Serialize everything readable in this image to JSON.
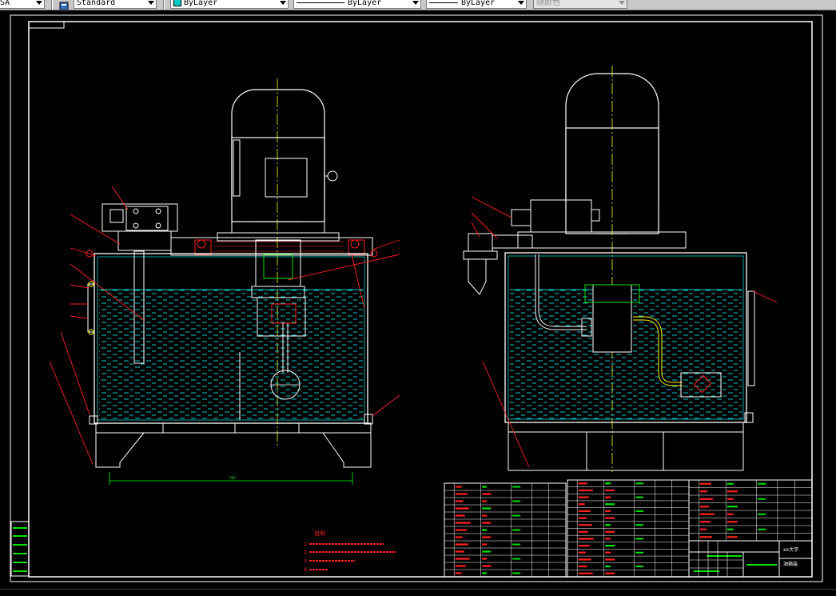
{
  "toolbar": {
    "textstyle_value": "Standard",
    "dimstyle_value": "SA",
    "layer_value": "ByLayer",
    "linetype_value": "ByLayer",
    "lineweight_value": "ByLayer",
    "plotstyle_value": "随颜色"
  },
  "drawing": {
    "notes_title": "说明",
    "notes": [
      "1.",
      "2.",
      "3.",
      "4."
    ],
    "dimension_width": "700",
    "title_school": "xx大学",
    "title_drawing": "油箱装",
    "colors": {
      "outline": "#ffffff",
      "oil": "#00c8c8",
      "callout": "#ff2020",
      "dimension": "#00ff00",
      "axis": "#ffff00",
      "parts_green": "#00e000",
      "magenta": "#ff00ff"
    }
  }
}
